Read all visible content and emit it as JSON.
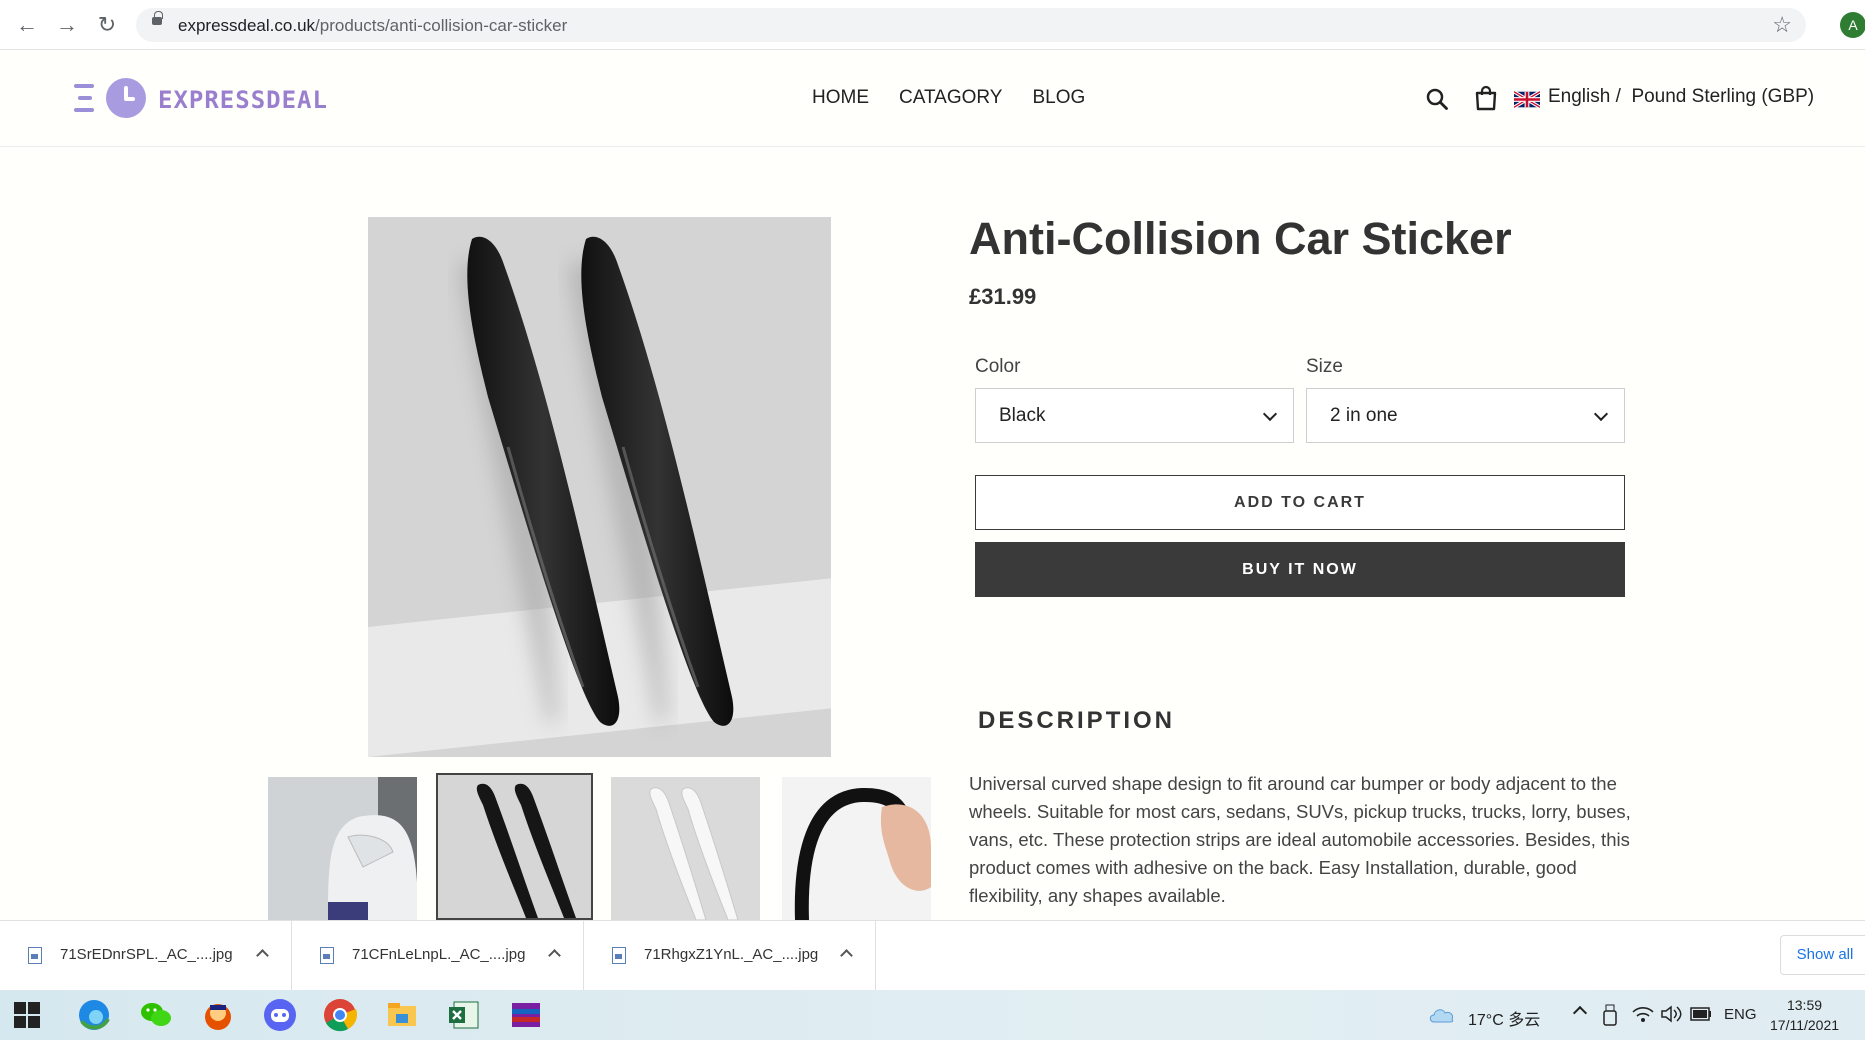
{
  "browser": {
    "url_domain": "expressdeal.co.uk",
    "url_path": "/products/anti-collision-car-sticker",
    "profile_initial": "A"
  },
  "header": {
    "logo_text": "EXPRESSDEAL",
    "nav": [
      "HOME",
      "CATAGORY",
      "BLOG"
    ],
    "language": "English /",
    "currency": "Pound Sterling (GBP)"
  },
  "product": {
    "title": "Anti-Collision Car Sticker",
    "price": "£31.99",
    "color_label": "Color",
    "color_value": "Black",
    "size_label": "Size",
    "size_value": "2 in one",
    "add_to_cart": "ADD TO CART",
    "buy_now": "BUY IT NOW",
    "description_heading": "DESCRIPTION",
    "description": "Universal curved shape design to fit around car bumper or body adjacent to the wheels. Suitable for most cars, sedans, SUVs, pickup trucks, trucks, lorry, buses, vans, etc. These protection strips are ideal automobile accessories. Besides, this product comes with adhesive on the back. Easy Installation, durable, good flexibility, any shapes available."
  },
  "downloads": {
    "items": [
      "71SrEDnrSPL._AC_....jpg",
      "71CFnLeLnpL._AC_....jpg",
      "71RhgxZ1YnL._AC_....jpg"
    ],
    "show_all": "Show all"
  },
  "taskbar": {
    "weather": "17°C 多云",
    "lang": "ENG",
    "time": "13:59",
    "date": "17/11/2021"
  }
}
